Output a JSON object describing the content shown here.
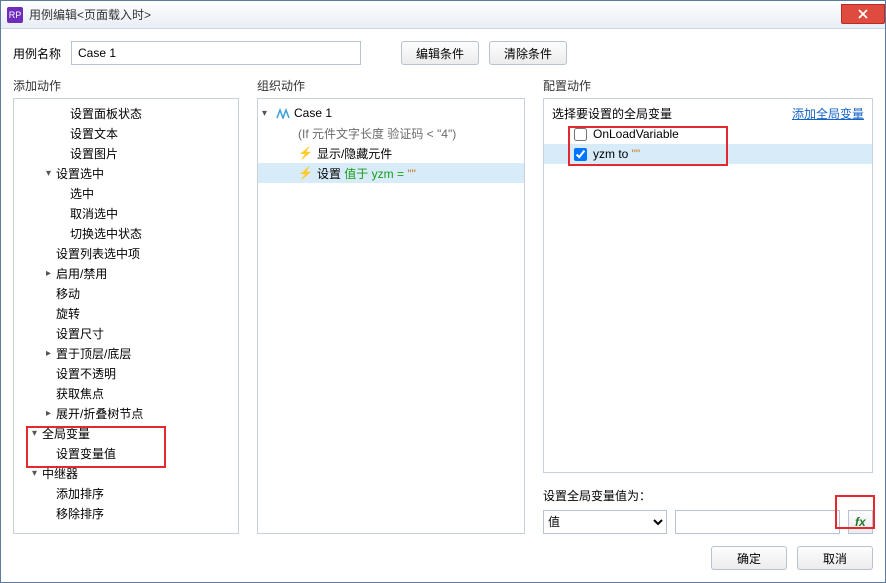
{
  "window": {
    "title": "用例编辑<页面载入时>"
  },
  "top": {
    "case_label": "用例名称",
    "case_value": "Case 1",
    "edit_cond": "编辑条件",
    "clear_cond": "清除条件"
  },
  "panels": {
    "add_label": "添加动作",
    "org_label": "组织动作",
    "cfg_label": "配置动作"
  },
  "add_tree": [
    {
      "indent": 3,
      "tri": "",
      "text": "设置面板状态"
    },
    {
      "indent": 3,
      "tri": "",
      "text": "设置文本"
    },
    {
      "indent": 3,
      "tri": "",
      "text": "设置图片"
    },
    {
      "indent": 2,
      "tri": "▾",
      "text": "设置选中"
    },
    {
      "indent": 3,
      "tri": "",
      "text": "选中"
    },
    {
      "indent": 3,
      "tri": "",
      "text": "取消选中"
    },
    {
      "indent": 3,
      "tri": "",
      "text": "切换选中状态"
    },
    {
      "indent": 2,
      "tri": "",
      "text": "设置列表选中项"
    },
    {
      "indent": 2,
      "tri": "▸",
      "text": "启用/禁用"
    },
    {
      "indent": 2,
      "tri": "",
      "text": "移动"
    },
    {
      "indent": 2,
      "tri": "",
      "text": "旋转"
    },
    {
      "indent": 2,
      "tri": "",
      "text": "设置尺寸"
    },
    {
      "indent": 2,
      "tri": "▸",
      "text": "置于顶层/底层"
    },
    {
      "indent": 2,
      "tri": "",
      "text": "设置不透明"
    },
    {
      "indent": 2,
      "tri": "",
      "text": "获取焦点"
    },
    {
      "indent": 2,
      "tri": "▸",
      "text": "展开/折叠树节点"
    },
    {
      "indent": 1,
      "tri": "▾",
      "text": "全局变量"
    },
    {
      "indent": 2,
      "tri": "",
      "text": "设置变量值"
    },
    {
      "indent": 1,
      "tri": "▾",
      "text": "中继器"
    },
    {
      "indent": 2,
      "tri": "",
      "text": "添加排序"
    },
    {
      "indent": 2,
      "tri": "",
      "text": "移除排序"
    }
  ],
  "org_tree": {
    "case": "Case 1",
    "cond": "(If 元件文字长度 验证码 < \"4\")",
    "row1": "显示/隐藏元件",
    "row2_prefix": "设置 ",
    "row2_green": "值于 yzm = ",
    "row2_quote": "\"\""
  },
  "cfg": {
    "select_label": "选择要设置的全局变量",
    "add_link": "添加全局变量",
    "vars": {
      "unchecked": "OnLoadVariable",
      "checked_name": "yzm to ",
      "checked_quote": "\"\""
    },
    "set_label": "设置全局变量值为：",
    "value_type_option": "值",
    "fx": "fx"
  },
  "footer": {
    "ok": "确定",
    "cancel": "取消"
  }
}
